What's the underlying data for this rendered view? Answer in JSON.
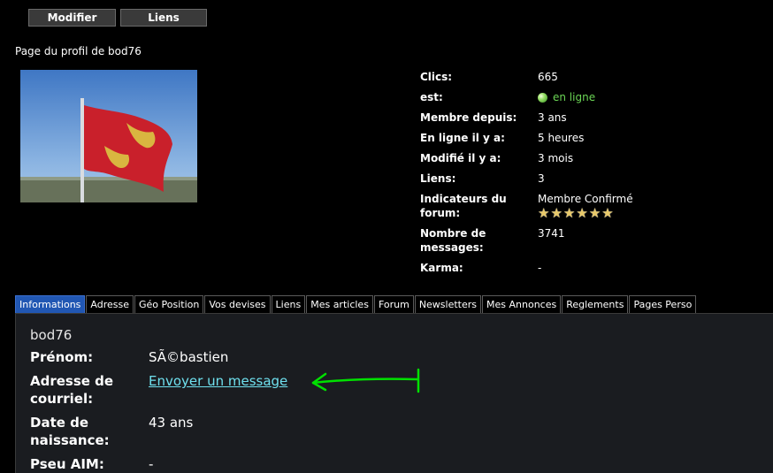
{
  "toolbar": {
    "modify_label": "Modifier",
    "links_label": "Liens"
  },
  "profile_title": "Page du profil de bod76",
  "info": {
    "clicks_label": "Clics:",
    "clicks_value": "665",
    "status_label": "est:",
    "status_value": "en ligne",
    "member_since_label": "Membre depuis:",
    "member_since_value": "3 ans",
    "online_ago_label": "En ligne il y a:",
    "online_ago_value": "5 heures",
    "modified_ago_label": "Modifié il y a:",
    "modified_ago_value": "3 mois",
    "links_label": "Liens:",
    "links_value": "3",
    "forum_indicators_label": "Indicateurs du forum:",
    "forum_indicators_value": "Membre Confirmé",
    "stars": 6,
    "messages_label": "Nombre de messages:",
    "messages_value": "3741",
    "karma_label": "Karma:",
    "karma_value": "-"
  },
  "tabs": [
    "Informations",
    "Adresse",
    "Géo Position",
    "Vos devises",
    "Liens",
    "Mes articles",
    "Forum",
    "Newsletters",
    "Mes Annonces",
    "Reglements",
    "Pages Perso"
  ],
  "active_tab": "Informations",
  "panel": {
    "username": "bod76",
    "firstname_label": "Prénom:",
    "firstname_value": "SÃ©bastien",
    "email_label": "Adresse de courriel:",
    "email_value": "Envoyer un message",
    "birth_label": "Date de naissance:",
    "birth_value": "43 ans",
    "aim_label": "Pseu AIM:",
    "aim_value": "-"
  },
  "colors": {
    "background": "#000000",
    "active_tab": "#2157b3",
    "link": "#6fe0ee",
    "online": "#6bd655",
    "arrow": "#00e000",
    "panel": "#1a1c20"
  },
  "icons": {
    "status": "online-dot-icon",
    "rating": "star-icon",
    "annotation": "green-arrow-icon"
  }
}
